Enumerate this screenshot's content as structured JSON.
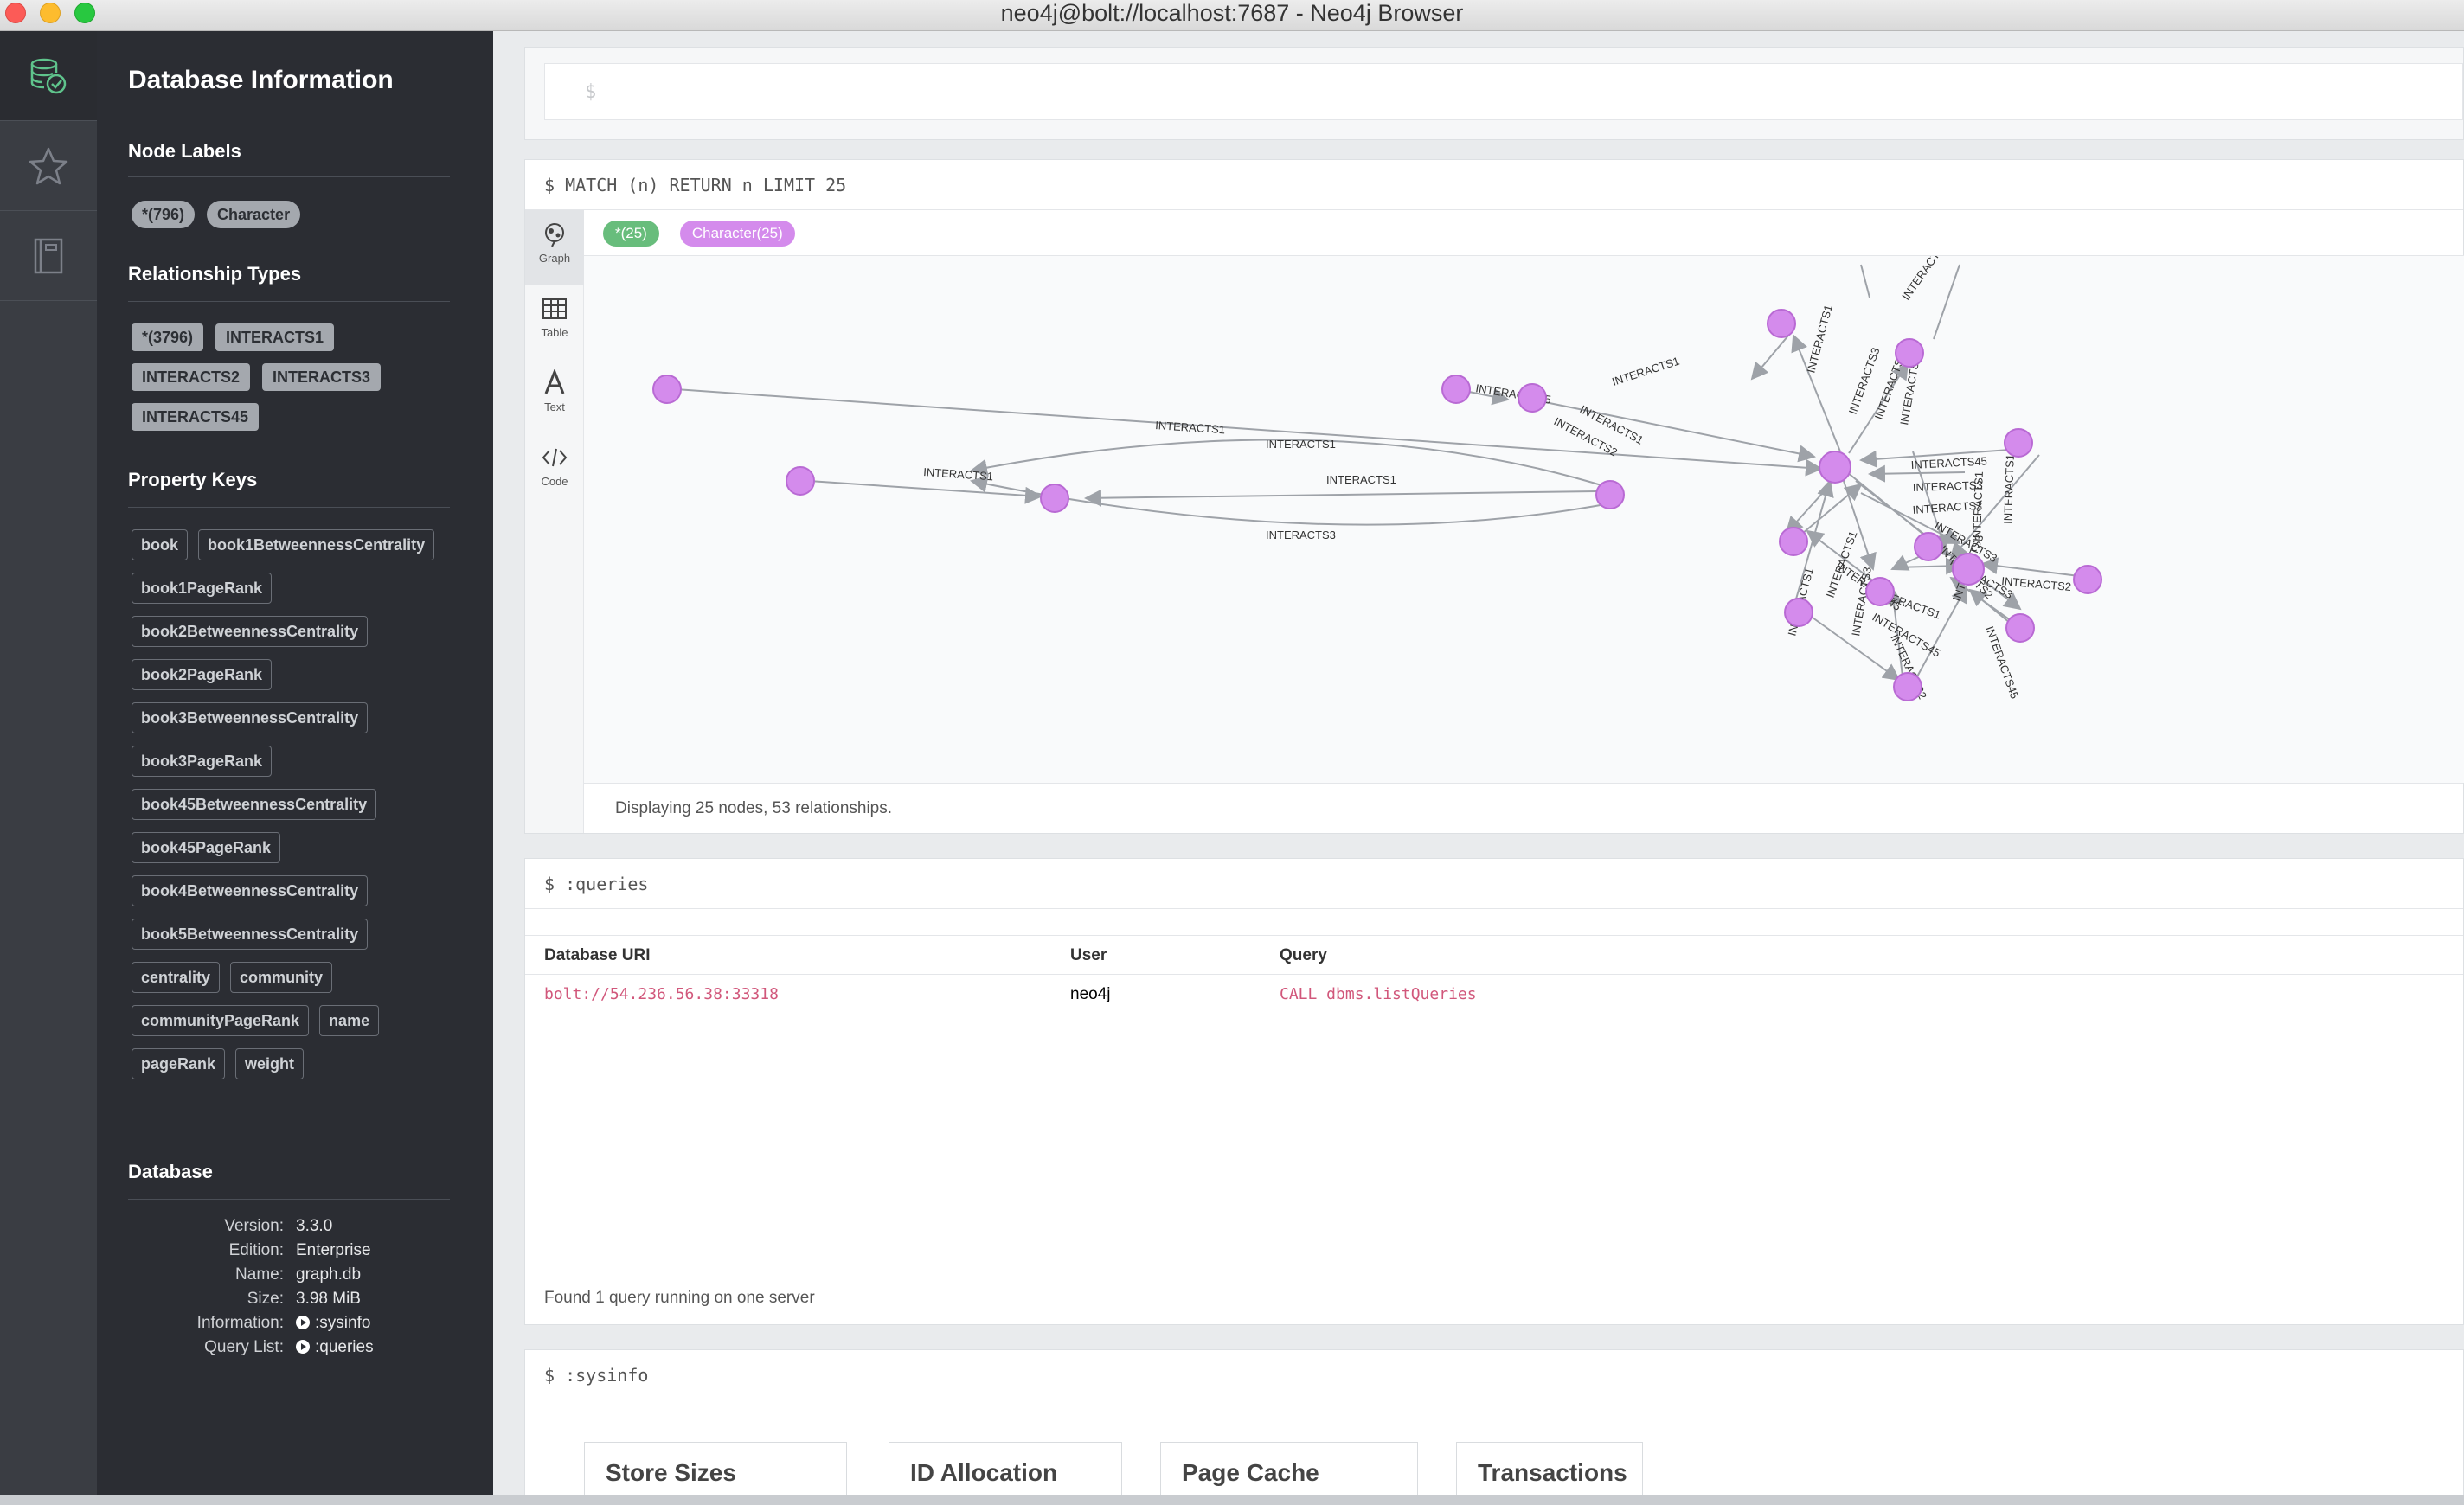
{
  "window": {
    "title": "neo4j@bolt://localhost:7687 - Neo4j Browser"
  },
  "rail": {
    "items": [
      "database-icon",
      "star-icon",
      "book-icon"
    ]
  },
  "drawer": {
    "title": "Database Information",
    "node_labels_title": "Node Labels",
    "node_labels": [
      "*(796)",
      "Character"
    ],
    "rel_types_title": "Relationship Types",
    "rel_types": [
      "*(3796)",
      "INTERACTS1",
      "INTERACTS2",
      "INTERACTS3",
      "INTERACTS45"
    ],
    "property_keys_title": "Property Keys",
    "property_keys": [
      "book",
      "book1BetweennessCentrality",
      "book1PageRank",
      "book2BetweennessCentrality",
      "book2PageRank",
      "book3BetweennessCentrality",
      "book3PageRank",
      "book45BetweennessCentrality",
      "book45PageRank",
      "book4BetweennessCentrality",
      "book5BetweennessCentrality",
      "centrality",
      "community",
      "communityPageRank",
      "name",
      "pageRank",
      "weight"
    ],
    "database_title": "Database",
    "database": {
      "version_label": "Version:",
      "version": "3.3.0",
      "edition_label": "Edition:",
      "edition": "Enterprise",
      "name_label": "Name:",
      "name": "graph.db",
      "size_label": "Size:",
      "size": "3.98 MiB",
      "information_label": "Information:",
      "information": ":sysinfo",
      "query_list_label": "Query List:",
      "query_list": ":queries"
    }
  },
  "editor": {
    "prompt": "$"
  },
  "graph_frame": {
    "command": "$ MATCH (n) RETURN n LIMIT 25",
    "tabs": [
      "Graph",
      "Table",
      "Text",
      "Code"
    ],
    "chips": [
      "*(25)",
      "Character(25)"
    ],
    "status": "Displaying 25 nodes, 53 relationships.",
    "colors": {
      "node_fill": "#d48bec",
      "node_stroke": "#b96ad4",
      "edge": "#9ea2a8",
      "chip_all": "#68bd7c"
    }
  },
  "queries_frame": {
    "command": "$ :queries",
    "columns": [
      "Database URI",
      "User",
      "Query"
    ],
    "rows": [
      {
        "uri": "bolt://54.236.56.38:33318",
        "user": "neo4j",
        "query": "CALL dbms.listQueries"
      }
    ],
    "footer": "Found 1 query running on one server"
  },
  "sysinfo_frame": {
    "command": "$ :sysinfo",
    "boxes": [
      "Store Sizes",
      "ID Allocation",
      "Page Cache",
      "Transactions"
    ]
  }
}
